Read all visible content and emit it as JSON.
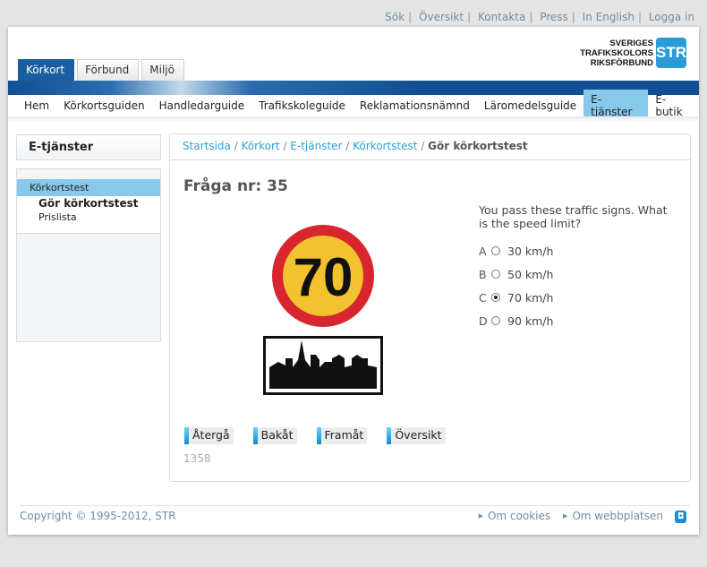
{
  "top_links": [
    "Sök",
    "Översikt",
    "Kontakta",
    "Press",
    "In English",
    "Logga in"
  ],
  "logo": {
    "lines": [
      "SVERIGES",
      "TRAFIKSKOLORS",
      "RIKSFÖRBUND"
    ],
    "mark": "STR"
  },
  "tabs": [
    {
      "label": "Körkort",
      "active": true
    },
    {
      "label": "Förbund"
    },
    {
      "label": "Miljö"
    }
  ],
  "nav": [
    "Hem",
    "Körkortsguiden",
    "Handledarguide",
    "Trafikskoleguide",
    "Reklamationsnämnd",
    "Läromedelsguide",
    "E-tjänster",
    "E-butik"
  ],
  "nav_active": "E-tjänster",
  "sidebar": {
    "title": "E-tjänster",
    "item": "Körkortstest",
    "subitems": [
      "Gör körkortstest",
      "Prislista"
    ]
  },
  "breadcrumb": [
    "Startsida",
    "Körkort",
    "E-tjänster",
    "Körkortstest"
  ],
  "breadcrumb_current": "Gör körkortstest",
  "question": {
    "title": "Fråga nr: 35",
    "text": "You pass these traffic signs. What is the speed limit?",
    "sign_speed": "70",
    "options": [
      {
        "letter": "A",
        "label": "30 km/h"
      },
      {
        "letter": "B",
        "label": "50 km/h"
      },
      {
        "letter": "C",
        "label": "70 km/h",
        "selected": true
      },
      {
        "letter": "D",
        "label": "90 km/h"
      }
    ]
  },
  "buttons": [
    "Återgå",
    "Bakåt",
    "Framåt",
    "Översikt"
  ],
  "code": "1358",
  "footer": {
    "copyright": "Copyright © 1995-2012, STR",
    "links": [
      "Om cookies",
      "Om webbplatsen"
    ]
  }
}
